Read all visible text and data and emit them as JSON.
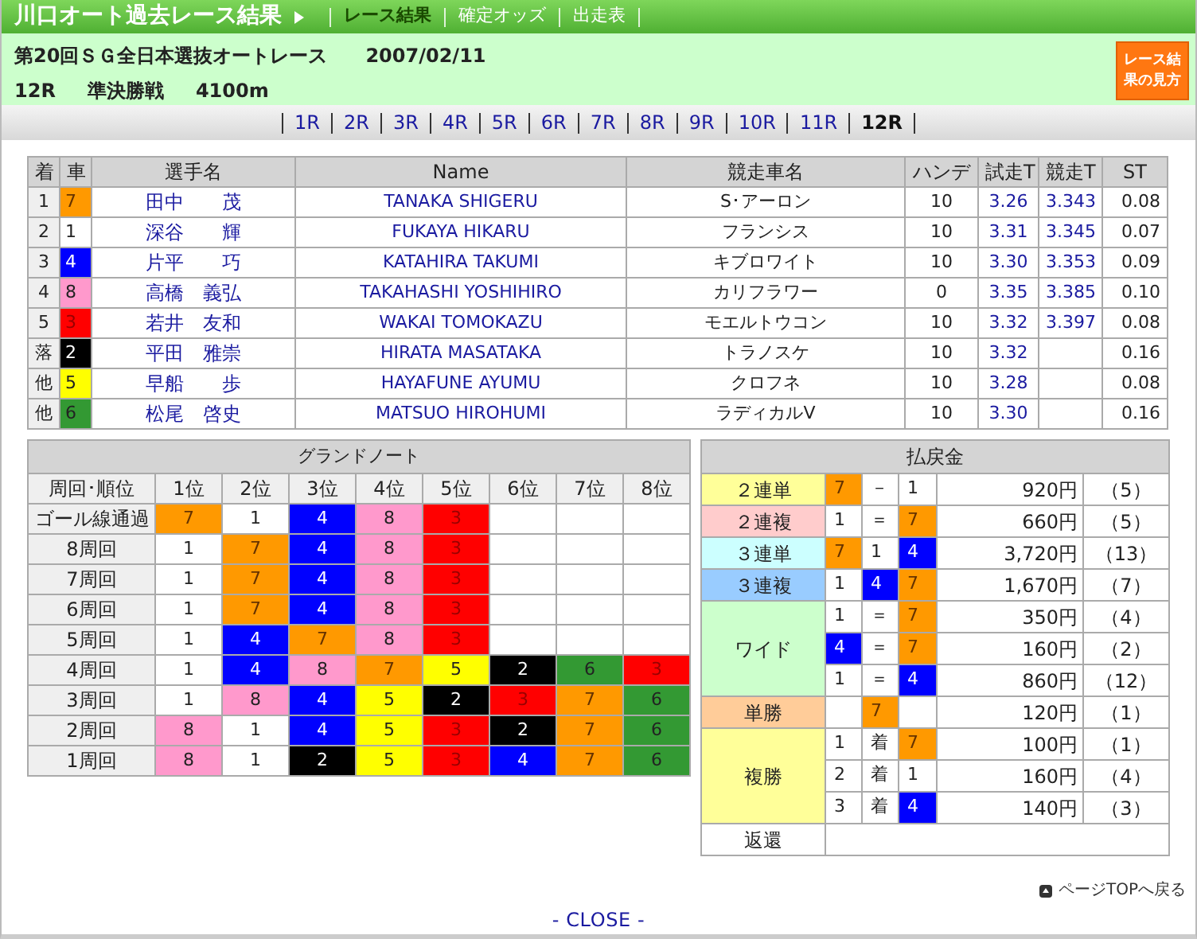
{
  "header": {
    "title": "川口オート過去レース結果",
    "links": [
      {
        "label": "レース結果",
        "selected": true
      },
      {
        "label": "確定オッズ",
        "selected": false
      },
      {
        "label": "出走表",
        "selected": false
      }
    ]
  },
  "race": {
    "event": "第20回ＳＧ全日本選抜オートレース",
    "date": "2007/02/11",
    "number": "12R",
    "grade": "準決勝戦",
    "distance": "4100m",
    "guide_button": "レース結果の見方"
  },
  "race_tabs": [
    {
      "label": "1R",
      "selected": false
    },
    {
      "label": "2R",
      "selected": false
    },
    {
      "label": "3R",
      "selected": false
    },
    {
      "label": "4R",
      "selected": false
    },
    {
      "label": "5R",
      "selected": false
    },
    {
      "label": "6R",
      "selected": false
    },
    {
      "label": "7R",
      "selected": false
    },
    {
      "label": "8R",
      "selected": false
    },
    {
      "label": "9R",
      "selected": false
    },
    {
      "label": "10R",
      "selected": false
    },
    {
      "label": "11R",
      "selected": false
    },
    {
      "label": "12R",
      "selected": true
    }
  ],
  "results": {
    "columns": [
      "着",
      "車",
      "選手名",
      "Name",
      "競走車名",
      "ハンデ",
      "試走T",
      "競走T",
      "ST"
    ],
    "rows": [
      {
        "place": "1",
        "car": "7",
        "color": "#ff9900",
        "rider": "田中　　茂",
        "name": "TANAKA SHIGERU",
        "machine": "S･アーロン",
        "handicap": "10",
        "trial": "3.26",
        "race_time": "3.343",
        "st": "0.08"
      },
      {
        "place": "2",
        "car": "1",
        "color": "#ffffff",
        "rider": "深谷　　輝",
        "name": "FUKAYA HIKARU",
        "machine": "フランシス",
        "handicap": "10",
        "trial": "3.31",
        "race_time": "3.345",
        "st": "0.07"
      },
      {
        "place": "3",
        "car": "4",
        "color": "#0000ff",
        "rider": "片平　　巧",
        "name": "KATAHIRA TAKUMI",
        "machine": "キブロワイト",
        "handicap": "10",
        "trial": "3.30",
        "race_time": "3.353",
        "st": "0.09"
      },
      {
        "place": "4",
        "car": "8",
        "color": "#ff99cc",
        "rider": "高橋　義弘",
        "name": "TAKAHASHI YOSHIHIRO",
        "machine": "カリフラワー",
        "handicap": "0",
        "trial": "3.35",
        "race_time": "3.385",
        "st": "0.10"
      },
      {
        "place": "5",
        "car": "3",
        "color": "#ff0000",
        "rider": "若井　友和",
        "name": "WAKAI TOMOKAZU",
        "machine": "モエルトウコン",
        "handicap": "10",
        "trial": "3.32",
        "race_time": "3.397",
        "st": "0.08"
      },
      {
        "place": "落",
        "car": "2",
        "color": "#000000",
        "rider": "平田　雅崇",
        "name": "HIRATA MASATAKA",
        "machine": "トラノスケ",
        "handicap": "10",
        "trial": "3.32",
        "st": "0.16"
      },
      {
        "place": "他",
        "car": "5",
        "color": "#ffff00",
        "rider": "早船　　歩",
        "name": "HAYAFUNE AYUMU",
        "machine": "クロフネ",
        "handicap": "10",
        "trial": "3.28",
        "st": "0.08"
      },
      {
        "place": "他",
        "car": "6",
        "color": "#339933",
        "rider": "松尾　啓史",
        "name": "MATSUO HIROHUMI",
        "machine": "ラディカルV",
        "handicap": "10",
        "trial": "3.30",
        "st": "0.16"
      }
    ]
  },
  "grand_note": {
    "title": "グランドノート",
    "columns": [
      "周回･順位",
      "1位",
      "2位",
      "3位",
      "4位",
      "5位",
      "6位",
      "7位",
      "8位"
    ],
    "rows": [
      {
        "lap": "ゴール線通過",
        "cars": [
          {
            "car": "7",
            "color": "#ff9900"
          },
          {
            "car": "1",
            "color": "#ffffff"
          },
          {
            "car": "4",
            "color": "#0000ff"
          },
          {
            "car": "8",
            "color": "#ff99cc"
          },
          {
            "car": "3",
            "color": "#ff0000"
          }
        ]
      },
      {
        "lap": "8周回",
        "cars": [
          {
            "car": "1",
            "color": "#ffffff"
          },
          {
            "car": "7",
            "color": "#ff9900"
          },
          {
            "car": "4",
            "color": "#0000ff"
          },
          {
            "car": "8",
            "color": "#ff99cc"
          },
          {
            "car": "3",
            "color": "#ff0000"
          }
        ]
      },
      {
        "lap": "7周回",
        "cars": [
          {
            "car": "1",
            "color": "#ffffff"
          },
          {
            "car": "7",
            "color": "#ff9900"
          },
          {
            "car": "4",
            "color": "#0000ff"
          },
          {
            "car": "8",
            "color": "#ff99cc"
          },
          {
            "car": "3",
            "color": "#ff0000"
          }
        ]
      },
      {
        "lap": "6周回",
        "cars": [
          {
            "car": "1",
            "color": "#ffffff"
          },
          {
            "car": "7",
            "color": "#ff9900"
          },
          {
            "car": "4",
            "color": "#0000ff"
          },
          {
            "car": "8",
            "color": "#ff99cc"
          },
          {
            "car": "3",
            "color": "#ff0000"
          }
        ]
      },
      {
        "lap": "5周回",
        "cars": [
          {
            "car": "1",
            "color": "#ffffff"
          },
          {
            "car": "4",
            "color": "#0000ff"
          },
          {
            "car": "7",
            "color": "#ff9900"
          },
          {
            "car": "8",
            "color": "#ff99cc"
          },
          {
            "car": "3",
            "color": "#ff0000"
          }
        ]
      },
      {
        "lap": "4周回",
        "cars": [
          {
            "car": "1",
            "color": "#ffffff"
          },
          {
            "car": "4",
            "color": "#0000ff"
          },
          {
            "car": "8",
            "color": "#ff99cc"
          },
          {
            "car": "7",
            "color": "#ff9900"
          },
          {
            "car": "5",
            "color": "#ffff00"
          },
          {
            "car": "2",
            "color": "#000000"
          },
          {
            "car": "6",
            "color": "#339933"
          },
          {
            "car": "3",
            "color": "#ff0000"
          }
        ]
      },
      {
        "lap": "3周回",
        "cars": [
          {
            "car": "1",
            "color": "#ffffff"
          },
          {
            "car": "8",
            "color": "#ff99cc"
          },
          {
            "car": "4",
            "color": "#0000ff"
          },
          {
            "car": "5",
            "color": "#ffff00"
          },
          {
            "car": "2",
            "color": "#000000"
          },
          {
            "car": "3",
            "color": "#ff0000"
          },
          {
            "car": "7",
            "color": "#ff9900"
          },
          {
            "car": "6",
            "color": "#339933"
          }
        ]
      },
      {
        "lap": "2周回",
        "cars": [
          {
            "car": "8",
            "color": "#ff99cc"
          },
          {
            "car": "1",
            "color": "#ffffff"
          },
          {
            "car": "4",
            "color": "#0000ff"
          },
          {
            "car": "5",
            "color": "#ffff00"
          },
          {
            "car": "3",
            "color": "#ff0000"
          },
          {
            "car": "2",
            "color": "#000000"
          },
          {
            "car": "7",
            "color": "#ff9900"
          },
          {
            "car": "6",
            "color": "#339933"
          }
        ]
      },
      {
        "lap": "1周回",
        "cars": [
          {
            "car": "8",
            "color": "#ff99cc"
          },
          {
            "car": "1",
            "color": "#ffffff"
          },
          {
            "car": "2",
            "color": "#000000"
          },
          {
            "car": "5",
            "color": "#ffff00"
          },
          {
            "car": "3",
            "color": "#ff0000"
          },
          {
            "car": "4",
            "color": "#0000ff"
          },
          {
            "car": "7",
            "color": "#ff9900"
          },
          {
            "car": "6",
            "color": "#339933"
          }
        ]
      }
    ]
  },
  "payouts": {
    "title": "払戻金",
    "groups": [
      {
        "label": "２連単",
        "color": "#ffff99",
        "rows": [
          {
            "cells": [
              {
                "text": "7",
                "color": "#ff9900"
              },
              {
                "text": "－"
              },
              {
                "text": "1"
              }
            ],
            "amount": "920円",
            "popularity": "（5）"
          }
        ]
      },
      {
        "label": "２連複",
        "color": "#ffcccc",
        "rows": [
          {
            "cells": [
              {
                "text": "1"
              },
              {
                "text": "＝"
              },
              {
                "text": "7",
                "color": "#ff9900"
              }
            ],
            "amount": "660円",
            "popularity": "（5）"
          }
        ]
      },
      {
        "label": "３連単",
        "color": "#ccffff",
        "rows": [
          {
            "cells": [
              {
                "text": "7",
                "color": "#ff9900"
              },
              {
                "text": "1"
              },
              {
                "text": "4",
                "color": "#0000ff"
              }
            ],
            "amount": "3,720円",
            "popularity": "（13）"
          }
        ]
      },
      {
        "label": "３連複",
        "color": "#99ccff",
        "rows": [
          {
            "cells": [
              {
                "text": "1"
              },
              {
                "text": "4",
                "color": "#0000ff"
              },
              {
                "text": "7",
                "color": "#ff9900"
              }
            ],
            "amount": "1,670円",
            "popularity": "（7）"
          }
        ]
      },
      {
        "label": "ワイド",
        "color": "#ccffcc",
        "rows": [
          {
            "cells": [
              {
                "text": "1"
              },
              {
                "text": "＝"
              },
              {
                "text": "7",
                "color": "#ff9900"
              }
            ],
            "amount": "350円",
            "popularity": "（4）"
          },
          {
            "cells": [
              {
                "text": "4",
                "color": "#0000ff"
              },
              {
                "text": "＝"
              },
              {
                "text": "7",
                "color": "#ff9900"
              }
            ],
            "amount": "160円",
            "popularity": "（2）"
          },
          {
            "cells": [
              {
                "text": "1"
              },
              {
                "text": "＝"
              },
              {
                "text": "4",
                "color": "#0000ff"
              }
            ],
            "amount": "860円",
            "popularity": "（12）"
          }
        ]
      },
      {
        "label": "単勝",
        "color": "#ffcc99",
        "rows": [
          {
            "cells": [
              {},
              {
                "text": "7",
                "color": "#ff9900"
              },
              {}
            ],
            "amount": "120円",
            "popularity": "（1）"
          }
        ]
      },
      {
        "label": "複勝",
        "color": "#ffff99",
        "rows": [
          {
            "cells": [
              {
                "text": "1"
              },
              {
                "text": "着"
              },
              {
                "text": "7",
                "color": "#ff9900"
              }
            ],
            "amount": "100円",
            "popularity": "（1）"
          },
          {
            "cells": [
              {
                "text": "2"
              },
              {
                "text": "着"
              },
              {
                "text": "1"
              }
            ],
            "amount": "160円",
            "popularity": "（4）"
          },
          {
            "cells": [
              {
                "text": "3"
              },
              {
                "text": "着"
              },
              {
                "text": "4",
                "color": "#0000ff"
              }
            ],
            "amount": "140円",
            "popularity": "（3）"
          }
        ]
      },
      {
        "label": "返還",
        "color": "#ffffff"
      }
    ]
  },
  "page_top_link": "ページTOPへ戻る",
  "close_link": "- CLOSE -"
}
